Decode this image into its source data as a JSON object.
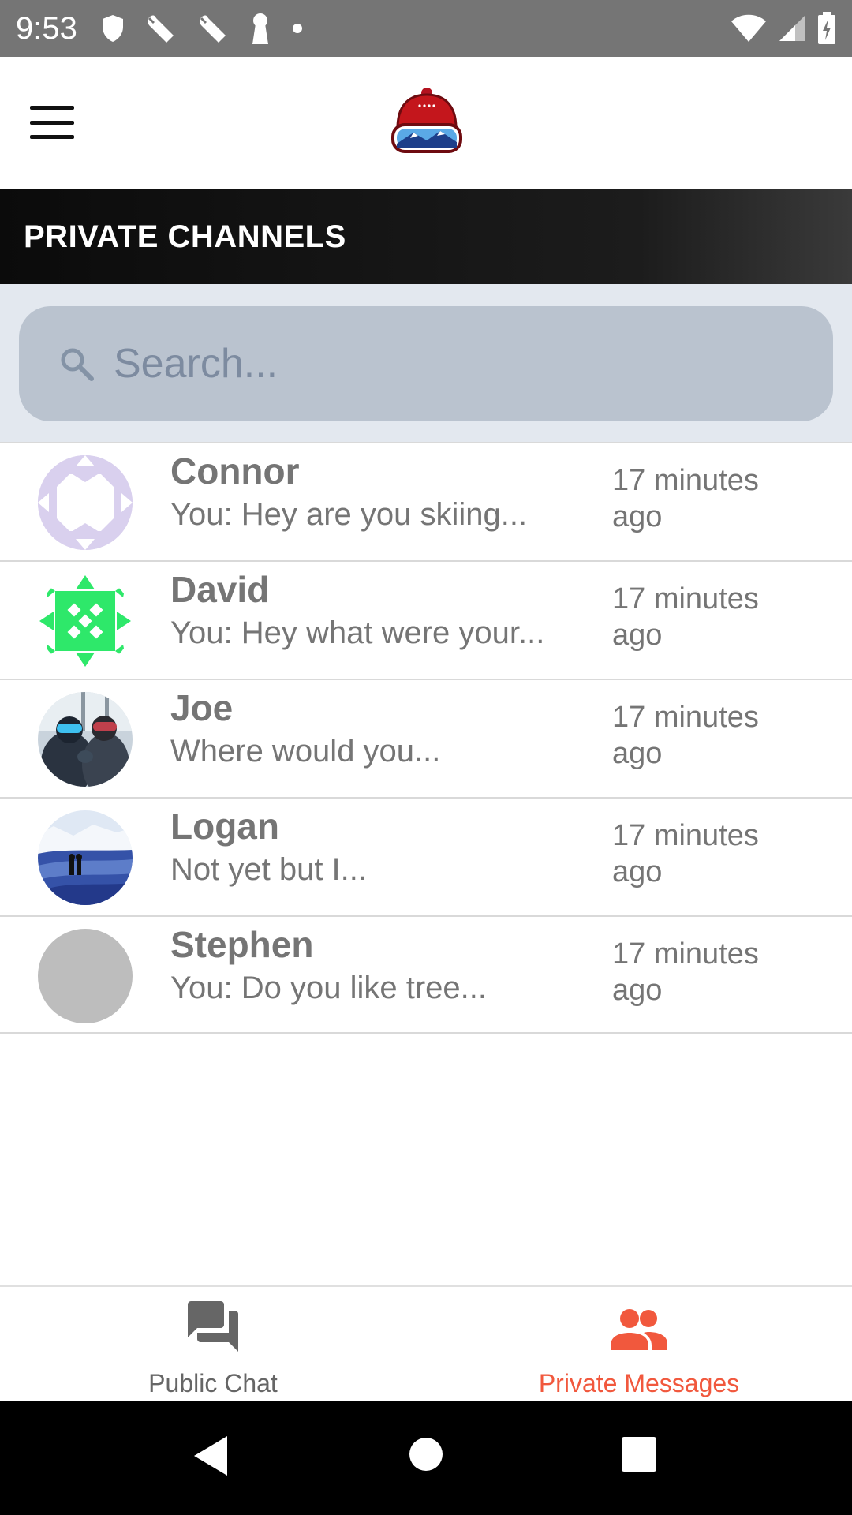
{
  "status_bar": {
    "time": "9:53"
  },
  "header": {
    "menu_icon": "hamburger-menu-icon",
    "logo": "beanie-goggles-logo"
  },
  "section": {
    "title": "PRIVATE CHANNELS"
  },
  "search": {
    "placeholder": "Search...",
    "value": "",
    "icon": "search-icon"
  },
  "channels": [
    {
      "name": "Connor",
      "preview": "You: Hey are you skiing...",
      "time_line1": "17 minutes",
      "time_line2": "ago",
      "avatar": "pattern-lavender"
    },
    {
      "name": "David",
      "preview": "You: Hey what were your...",
      "time_line1": "17 minutes",
      "time_line2": "ago",
      "avatar": "pattern-green"
    },
    {
      "name": "Joe",
      "preview": "Where would you...",
      "time_line1": "17 minutes",
      "time_line2": "ago",
      "avatar": "photo-goggles"
    },
    {
      "name": "Logan",
      "preview": "Not yet but I...",
      "time_line1": "17 minutes",
      "time_line2": "ago",
      "avatar": "photo-snow"
    },
    {
      "name": "Stephen",
      "preview": "You: Do you like tree...",
      "time_line1": "17 minutes",
      "time_line2": "ago",
      "avatar": "placeholder-gray"
    }
  ],
  "tabs": [
    {
      "label": "Public Chat",
      "icon": "chat-bubbles-icon",
      "active": false
    },
    {
      "label": "Private Messages",
      "icon": "people-icon",
      "active": true
    }
  ],
  "colors": {
    "accent": "#f1583d",
    "status_bar": "#757575",
    "search_bg": "#bac3cf",
    "search_area": "#e3e8ef",
    "text_gray": "#757575"
  }
}
